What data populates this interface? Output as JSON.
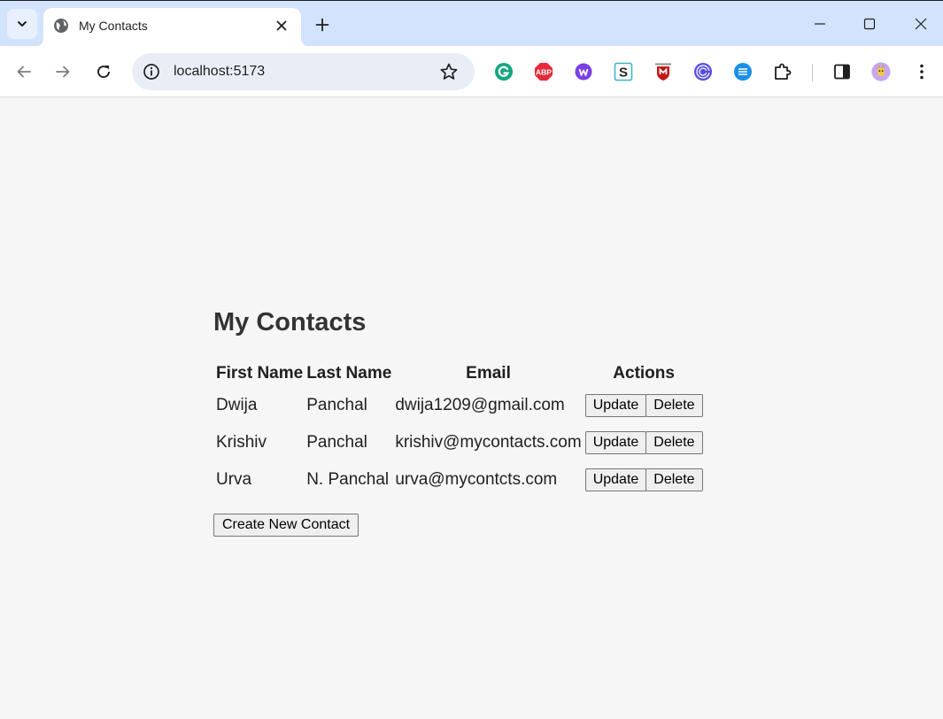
{
  "browser": {
    "tab_title": "My Contacts",
    "url": "localhost:5173",
    "extensions": [
      "grammarly-icon",
      "adblock-plus-icon",
      "wordtune-icon",
      "s-extension-icon",
      "mcafee-icon",
      "radar-extension-icon",
      "blue-list-extension-icon",
      "extensions-puzzle-icon"
    ],
    "adblock_label": "ABP",
    "s_label": "S"
  },
  "page": {
    "title": "My Contacts",
    "columns": [
      "First Name",
      "Last Name",
      "Email",
      "Actions"
    ],
    "rows": [
      {
        "first": "Dwija",
        "last": "Panchal",
        "email": "dwija1209@gmail.com"
      },
      {
        "first": "Krishiv",
        "last": "Panchal",
        "email": "krishiv@mycontacts.com"
      },
      {
        "first": "Urva",
        "last": "N. Panchal",
        "email": "urva@mycontcts.com"
      }
    ],
    "update_label": "Update",
    "delete_label": "Delete",
    "create_label": "Create New Contact"
  },
  "colors": {
    "tabstrip": "#d3e3fd",
    "page_background": "#f6f6f6",
    "title_text": "#333333"
  }
}
